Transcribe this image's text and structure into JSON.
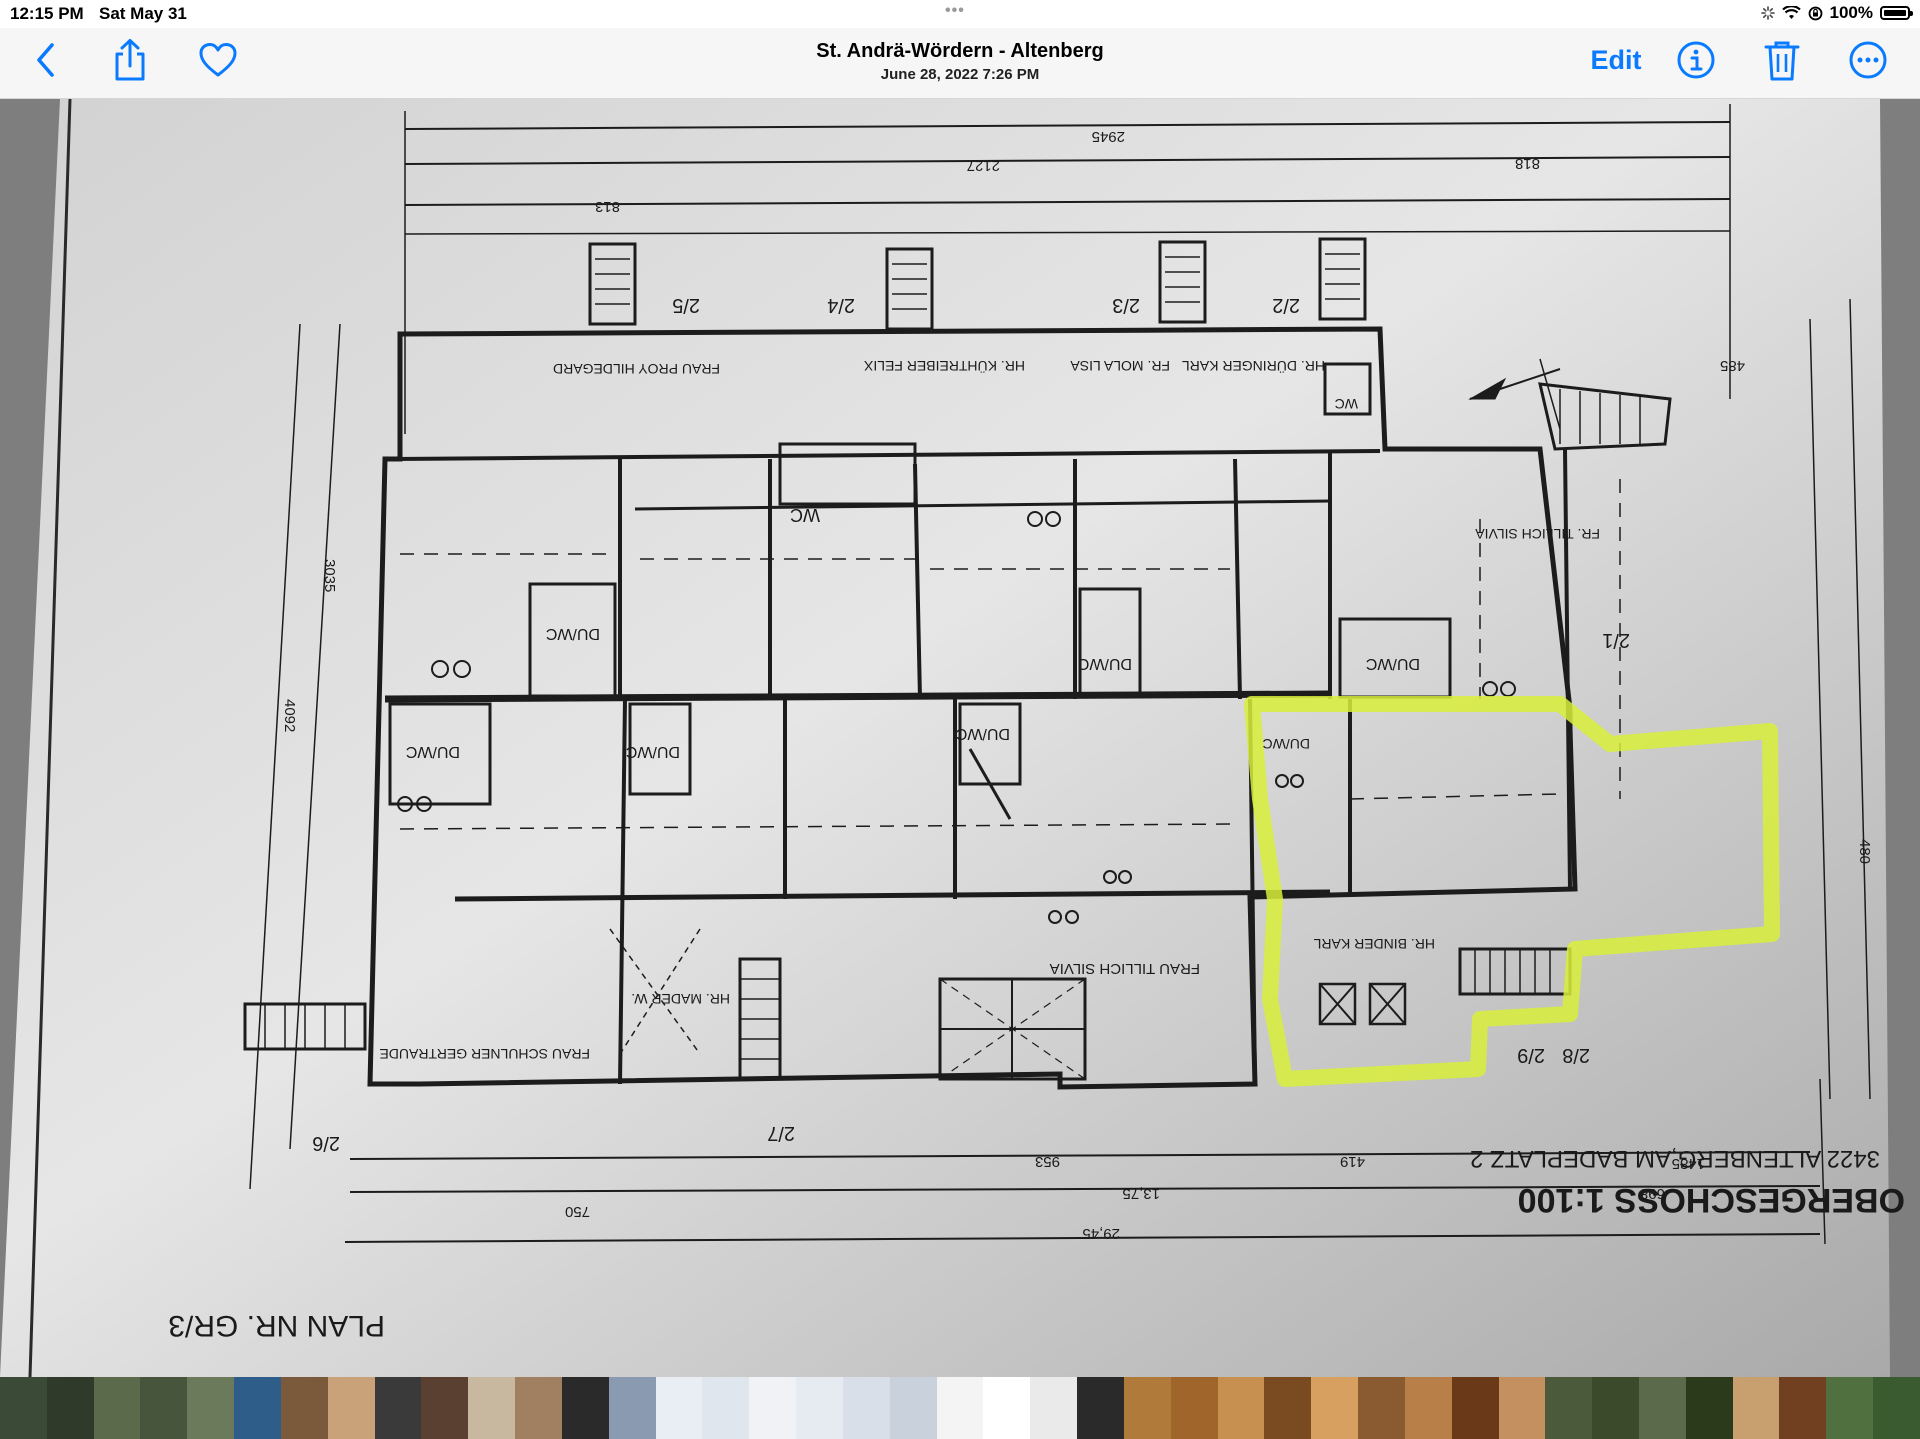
{
  "status_bar": {
    "time": "12:15 PM",
    "date": "Sat May 31",
    "battery": "100%",
    "battery_level": 1.0
  },
  "toolbar": {
    "back_icon": "chevron-left-icon",
    "share_icon": "share-icon",
    "favorite_icon": "heart-icon",
    "title": "St. Andrä-Wördern - Altenberg",
    "subtitle": "June 28, 2022  7:26 PM",
    "edit_label": "Edit",
    "info_icon": "info-icon",
    "delete_icon": "trash-icon",
    "more_icon": "ellipsis-circle-icon"
  },
  "photo": {
    "plan_title": "OBERGESCHOSS   1:100",
    "plan_address": "3422 ALTENBERG,AM BADEPLATZ 2",
    "plan_number": "PLAN  NR. GR/3",
    "unit_labels": [
      "2/5",
      "2/4",
      "2/3",
      "2/2",
      "2/1",
      "2/6",
      "2/7",
      "2/8",
      "2/9"
    ],
    "room_labels": [
      "WC",
      "DU/WC",
      "DU/WC",
      "DU/WC",
      "DU/WC",
      "DU/WC",
      "DU/WC",
      "WC",
      "DU/WC"
    ],
    "tenant_labels": [
      "FRAU PROY HILDEGARD",
      "HR. KÜHTREIBER FELIX",
      "FR. MOLA LISA",
      "HR. DÜRINGER KARL",
      "FR. TILLICH SILVIA",
      "FRAU TILLICH SILVIA",
      "HR. BINDER KARL",
      "FRAU SCHULNER GERTRAUDE",
      "HR. MADER W."
    ],
    "dimension_labels": [
      "2945",
      "2127",
      "818",
      "813",
      "1485",
      "29,45",
      "750",
      "13,75",
      "953",
      "419",
      "698",
      "485",
      "4092",
      "3035",
      "480"
    ],
    "highlight_color": "#d8ef3a"
  },
  "thumbnails": {
    "colors": [
      "#3a4a36",
      "#2f3a2b",
      "#5b6a4a",
      "#46553c",
      "#6b7a5a",
      "#2e5d8a",
      "#7a5a3a",
      "#c9a27a",
      "#3a3a3a",
      "#5a4030",
      "#c8b8a0",
      "#a08060",
      "#2a2a2a",
      "#8a9ab0",
      "#e8eef4",
      "#dfe6ee",
      "#f0f2f5",
      "#e6ebf1",
      "#d8dfe8",
      "#c9d2dc",
      "#f4f4f4",
      "#ffffff",
      "#eaeaea",
      "#2a2a2a",
      "#b07a3a",
      "#a0652a",
      "#c89050",
      "#7a4a20",
      "#d8a060",
      "#8a5a30",
      "#b88048",
      "#6a3a18",
      "#c49060",
      "#4a5a3a",
      "#3a4a2a",
      "#5a6a4a",
      "#2a3a1a",
      "#c8a070",
      "#704020",
      "#507040",
      "#3a5a30"
    ]
  }
}
